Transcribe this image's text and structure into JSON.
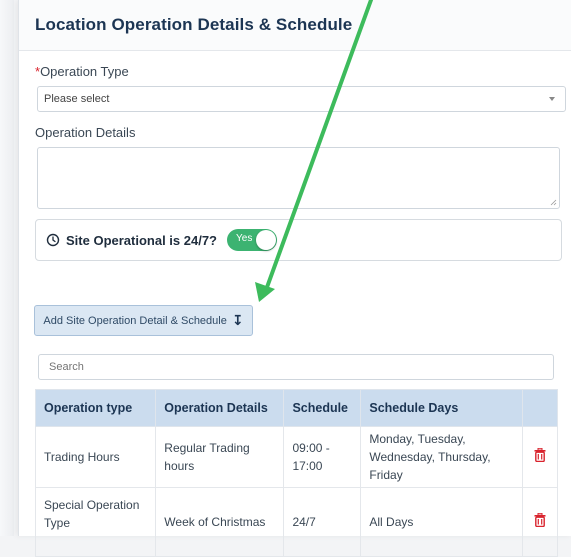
{
  "panel": {
    "title": "Location Operation Details & Schedule"
  },
  "form": {
    "operation_type": {
      "required_mark": "*",
      "label": "Operation Type",
      "selected": "Please select"
    },
    "operation_details": {
      "label": "Operation Details",
      "value": ""
    },
    "site_operational": {
      "label": "Site Operational is 24/7?",
      "toggle_text": "Yes",
      "on": true
    },
    "add_button": {
      "label": "Add Site Operation Detail & Schedule",
      "icon": "↧"
    }
  },
  "search": {
    "placeholder": "Search"
  },
  "table": {
    "columns": [
      "Operation type",
      "Operation Details",
      "Schedule",
      "Schedule Days",
      ""
    ],
    "rows": [
      {
        "operation_type": "Trading Hours",
        "operation_details": "Regular Trading hours",
        "schedule": "09:00 - 17:00",
        "schedule_days": "Monday, Tuesday, Wednesday, Thursday, Friday"
      },
      {
        "operation_type": "Special Operation Type",
        "operation_details": "Week of Christmas",
        "schedule": "24/7",
        "schedule_days": "All Days"
      }
    ]
  },
  "colors": {
    "annotation_arrow": "#3dbb5c",
    "toggle_on": "#3cb371",
    "delete_icon": "#d9232d",
    "header_bg": "#cbdcee"
  }
}
